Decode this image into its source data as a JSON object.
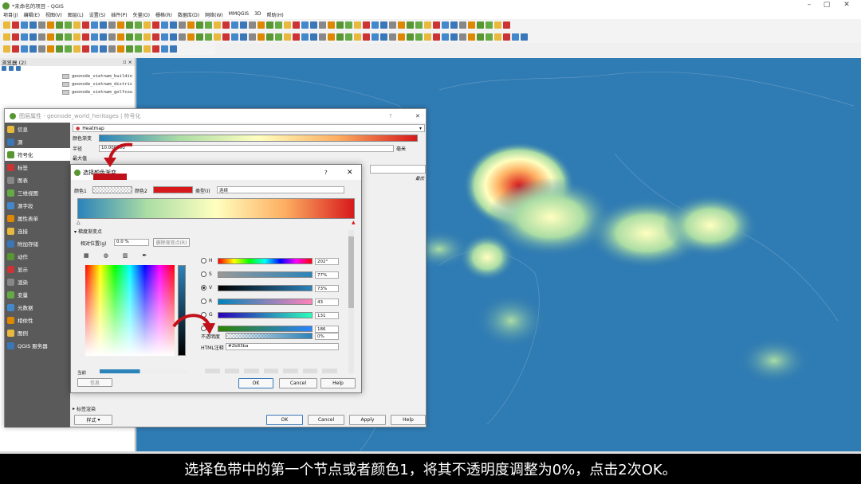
{
  "window": {
    "title": "*未命名的项目 - QGIS"
  },
  "menu": [
    "项目(J)",
    "编辑(E)",
    "视图(V)",
    "图层(L)",
    "设置(S)",
    "插件(P)",
    "矢量(O)",
    "栅格(R)",
    "数据库(D)",
    "网络(W)",
    "MMQGIS",
    "3D",
    "帮助(H)"
  ],
  "browser": {
    "title": "浏览器 (2)",
    "files": [
      "geonode_vietnam_buildin",
      "geonode_vietnam_distric",
      "geonode_vietnam_golfcou"
    ]
  },
  "props": {
    "title": "图层属性 - geonode_world_heritages | 符号化",
    "tabs": [
      "信息",
      "源",
      "符号化",
      "标签",
      "图表",
      "三维视图",
      "源字段",
      "属性表单",
      "连接",
      "附加存储",
      "动作",
      "显示",
      "渲染",
      "变量",
      "元数据",
      "相依性",
      "图例",
      "QGIS 服务器"
    ],
    "renderer": "Heatmap",
    "color_ramp_label": "颜色渐变",
    "radius_label": "半径",
    "radius_value": "10.000000",
    "radius_unit": "毫米",
    "max_label": "最大值",
    "max_side": "最优",
    "label_section": "标签渲染",
    "style_btn": "样式",
    "ok": "OK",
    "cancel": "Cancel",
    "apply": "Apply",
    "help": "Help"
  },
  "dialog": {
    "title": "选择颜色渐变",
    "help_icon": "?",
    "color1_label": "颜色1",
    "color2_label": "颜色2",
    "type_label": "类型(I)",
    "type_value": "连续",
    "gradient_section": "梯度渐变点",
    "rel_pos_label": "相对位置(g)",
    "rel_pos_value": "0.0 %",
    "delete_btn": "删除渐变点(R)",
    "channels": [
      {
        "k": "H",
        "v": "202°"
      },
      {
        "k": "S",
        "v": "77%"
      },
      {
        "k": "V",
        "v": "73%"
      },
      {
        "k": "R",
        "v": "43"
      },
      {
        "k": "G",
        "v": "131"
      },
      {
        "k": "B",
        "v": "186"
      }
    ],
    "opacity_label": "不透明度",
    "opacity_value": "0%",
    "html_label": "HTML注释",
    "html_value": "#2b83ba",
    "current_label": "当前",
    "info_btn": "信息",
    "ok": "OK",
    "cancel": "Cancel",
    "help": "Help"
  },
  "caption": "选择色带中的第一个节点或者颜色1，将其不透明度调整为0%，点击2次OK。"
}
